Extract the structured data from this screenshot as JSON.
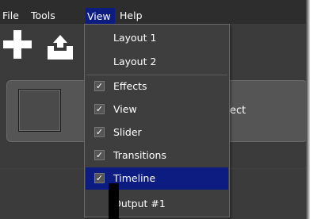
{
  "menubar": {
    "file": "File",
    "tools": "Tools",
    "view": "View",
    "help": "Help"
  },
  "toolbar": {
    "add_icon": "plus-icon",
    "upload_icon": "upload-icon"
  },
  "track": {
    "label": "ffect"
  },
  "view_menu": {
    "items": [
      {
        "label": "Layout 1",
        "checked": false
      },
      {
        "label": "Layout 2",
        "checked": false
      },
      {
        "label": "Effects",
        "checked": true
      },
      {
        "label": "View",
        "checked": true
      },
      {
        "label": "Slider",
        "checked": true
      },
      {
        "label": "Transitions",
        "checked": true
      },
      {
        "label": "Timeline",
        "checked": true,
        "highlighted": true
      },
      {
        "label": "Output #1",
        "checked": false
      }
    ],
    "check_glyph": "✓"
  },
  "colors": {
    "background": "#3b3b3b",
    "menubar": "#2d2d2d",
    "highlight": "#0d1c80",
    "text": "#ffffff"
  }
}
